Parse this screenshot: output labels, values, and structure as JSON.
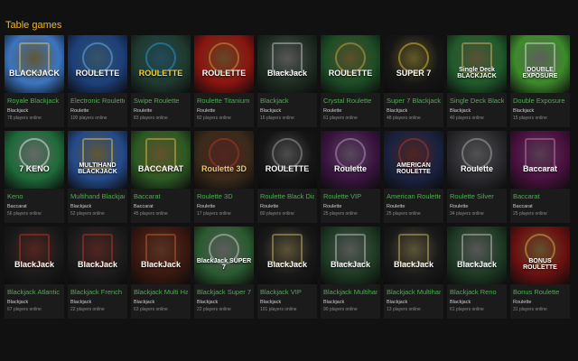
{
  "section": {
    "title": "Table games"
  },
  "games": [
    {
      "thumb_text": "BLACKJACK",
      "name": "Royale Blackjack",
      "category": "Blackjack",
      "players": "78 players online",
      "bg": "#3b74c0",
      "fg": "#ffffff",
      "accent": "#f0d060",
      "icon": "cards-icon"
    },
    {
      "thumb_text": "ROULETTE",
      "name": "Electronic Roulette",
      "category": "Roulette",
      "players": "100 players online",
      "bg": "#1d3f7a",
      "fg": "#ffffff",
      "accent": "#6ec3ff",
      "icon": "roulette-wheel-icon"
    },
    {
      "thumb_text": "ROULETTE",
      "name": "Swipe Roulette",
      "category": "Roulette",
      "players": "83 players online",
      "bg": "#1f3a2e",
      "fg": "#f6d23a",
      "accent": "#2fa7d9",
      "icon": "roulette-wheel-icon"
    },
    {
      "thumb_text": "ROULETTE",
      "name": "Roulette Titanium",
      "category": "Roulette",
      "players": "82 players online",
      "bg": "#8a1410",
      "fg": "#ffffff",
      "accent": "#f2a23a",
      "icon": "roulette-wheel-icon"
    },
    {
      "thumb_text": "BlackJack",
      "name": "Blackjack",
      "category": "Blackjack",
      "players": "16 players online",
      "bg": "#1e2c22",
      "fg": "#ffffff",
      "accent": "#cfcfcf",
      "icon": "cards-icon"
    },
    {
      "thumb_text": "ROULETTE",
      "name": "Crystal Roulette",
      "category": "Roulette",
      "players": "61 players online",
      "bg": "#1c4d26",
      "fg": "#ffffff",
      "accent": "#d8b84a",
      "icon": "roulette-wheel-icon"
    },
    {
      "thumb_text": "SUPER 7",
      "name": "Super 7 Blackjack",
      "category": "Blackjack",
      "players": "48 players online",
      "bg": "#161616",
      "fg": "#ffffff",
      "accent": "#f2d23a",
      "icon": "seven-icon"
    },
    {
      "thumb_text": "Single Deck BLACKJACK",
      "name": "Single Deck Blackjack",
      "category": "Blackjack",
      "players": "40 players online",
      "bg": "#1f5a2a",
      "fg": "#ffffff",
      "accent": "#d8c070",
      "icon": "cards-icon"
    },
    {
      "thumb_text": "DOUBLE EXPOSURE",
      "name": "Double Exposure",
      "category": "Blackjack",
      "players": "15 players online",
      "bg": "#3c8a2a",
      "fg": "#ffffff",
      "accent": "#e4e4e4",
      "icon": "cards-icon"
    },
    {
      "thumb_text": "7 KENO",
      "name": "Keno",
      "category": "Baccarat",
      "players": "56 players online",
      "bg": "#1e6a3a",
      "fg": "#ffffff",
      "accent": "#ffffff",
      "icon": "keno-ball-icon"
    },
    {
      "thumb_text": "MULTIHAND BLACKJACK",
      "name": "Multihand Blackjack",
      "category": "Blackjack",
      "players": "52 players online",
      "bg": "#234a8a",
      "fg": "#ffffff",
      "accent": "#f0d060",
      "icon": "cards-icon"
    },
    {
      "thumb_text": "BACCARAT",
      "name": "Baccarat",
      "category": "Baccarat",
      "players": "45 players online",
      "bg": "#2b5a22",
      "fg": "#ffffff",
      "accent": "#f0c050",
      "icon": "cards-icon"
    },
    {
      "thumb_text": "Roulette 3D",
      "name": "Roulette 3D",
      "category": "Roulette",
      "players": "17 players online",
      "bg": "#3a2a1a",
      "fg": "#e8c870",
      "accent": "#c0392b",
      "icon": "roulette-wheel-icon"
    },
    {
      "thumb_text": "ROULETTE",
      "name": "Roulette Black Diamond",
      "category": "Roulette",
      "players": "80 players online",
      "bg": "#151515",
      "fg": "#ffffff",
      "accent": "#b0b0b0",
      "icon": "roulette-wheel-icon"
    },
    {
      "thumb_text": "Roulette",
      "name": "Roulette VIP",
      "category": "Roulette",
      "players": "25 players online",
      "bg": "#3a1440",
      "fg": "#ffffff",
      "accent": "#d0a0e0",
      "icon": "roulette-wheel-icon"
    },
    {
      "thumb_text": "AMERICAN ROULETTE",
      "name": "American Roulette",
      "category": "Roulette",
      "players": "25 players online",
      "bg": "#1a2240",
      "fg": "#ffffff",
      "accent": "#c0392b",
      "icon": "roulette-wheel-icon"
    },
    {
      "thumb_text": "Roulette",
      "name": "Roulette Silver",
      "category": "Roulette",
      "players": "34 players online",
      "bg": "#2a2a2e",
      "fg": "#ffffff",
      "accent": "#bcbcbc",
      "icon": "roulette-wheel-icon"
    },
    {
      "thumb_text": "Baccarat",
      "name": "Baccarat",
      "category": "Baccarat",
      "players": "25 players online",
      "bg": "#4a1040",
      "fg": "#ffffff",
      "accent": "#d080c0",
      "icon": "cards-icon"
    },
    {
      "thumb_text": "BlackJack",
      "name": "Blackjack Atlantic City",
      "category": "Blackjack",
      "players": "67 players online",
      "bg": "#1a1a1a",
      "fg": "#ffffff",
      "accent": "#c0392b",
      "icon": "cards-icon"
    },
    {
      "thumb_text": "BlackJack",
      "name": "Blackjack French",
      "category": "Blackjack",
      "players": "22 players online",
      "bg": "#1c1c1c",
      "fg": "#ffffff",
      "accent": "#c0392b",
      "icon": "cards-icon"
    },
    {
      "thumb_text": "BlackJack",
      "name": "Blackjack Multi Hand",
      "category": "Blackjack",
      "players": "63 players online",
      "bg": "#3a1810",
      "fg": "#ffffff",
      "accent": "#d06030",
      "icon": "cards-icon"
    },
    {
      "thumb_text": "BlackJack SUPER 7",
      "name": "Blackjack Super 7",
      "category": "Blackjack",
      "players": "22 players online",
      "bg": "#2a5a30",
      "fg": "#ffffff",
      "accent": "#e0e0e0",
      "icon": "seven-icon"
    },
    {
      "thumb_text": "BlackJack",
      "name": "Blackjack VIP",
      "category": "Blackjack",
      "players": "101 players online",
      "bg": "#181818",
      "fg": "#ffffff",
      "accent": "#d8c070",
      "icon": "cards-icon"
    },
    {
      "thumb_text": "BlackJack",
      "name": "Blackjack Multihand",
      "category": "Blackjack",
      "players": "90 players online",
      "bg": "#1e3a24",
      "fg": "#ffffff",
      "accent": "#cfcfcf",
      "icon": "cards-icon"
    },
    {
      "thumb_text": "BlackJack",
      "name": "Blackjack Multihand VIP",
      "category": "Blackjack",
      "players": "13 players online",
      "bg": "#1a1a1a",
      "fg": "#ffffff",
      "accent": "#d8c070",
      "icon": "cards-icon"
    },
    {
      "thumb_text": "BlackJack",
      "name": "Blackjack Reno",
      "category": "Blackjack",
      "players": "61 players online",
      "bg": "#1e3a24",
      "fg": "#ffffff",
      "accent": "#cfcfcf",
      "icon": "cards-icon"
    },
    {
      "thumb_text": "BONUS ROULETTE",
      "name": "Bonus Roulette",
      "category": "Roulette",
      "players": "31 players online",
      "bg": "#6a1010",
      "fg": "#ffffff",
      "accent": "#f0c050",
      "icon": "roulette-wheel-icon"
    }
  ]
}
